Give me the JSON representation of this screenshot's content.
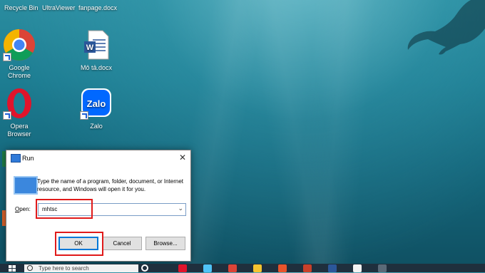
{
  "desktop": {
    "top_labels": [
      "Recycle Bin",
      "UltraViewer",
      "fanpage.docx"
    ],
    "icons": [
      {
        "name": "Google Chrome",
        "line1": "Google",
        "line2": "Chrome"
      },
      {
        "name": "Mô tả.docx",
        "line1": "Mô tả.docx",
        "line2": ""
      },
      {
        "name": "Opera Browser",
        "line1": "Opera",
        "line2": "Browser"
      },
      {
        "name": "Zalo",
        "line1": "Zalo",
        "line2": ""
      }
    ]
  },
  "run_dialog": {
    "title": "Run",
    "close": "✕",
    "description": "Type the name of a program, folder, document, or Internet resource, and Windows will open it for you.",
    "open_label_underlined": "O",
    "open_label_rest": "pen:",
    "open_value": "mhtsc",
    "dropdown": "⌄",
    "ok_label": "OK",
    "cancel_label": "Cancel",
    "browse_label": "Browse..."
  },
  "taskbar": {
    "search_placeholder": "Type here to search"
  },
  "colors": {
    "highlight": "#e01a1a",
    "accent": "#0078d7"
  }
}
